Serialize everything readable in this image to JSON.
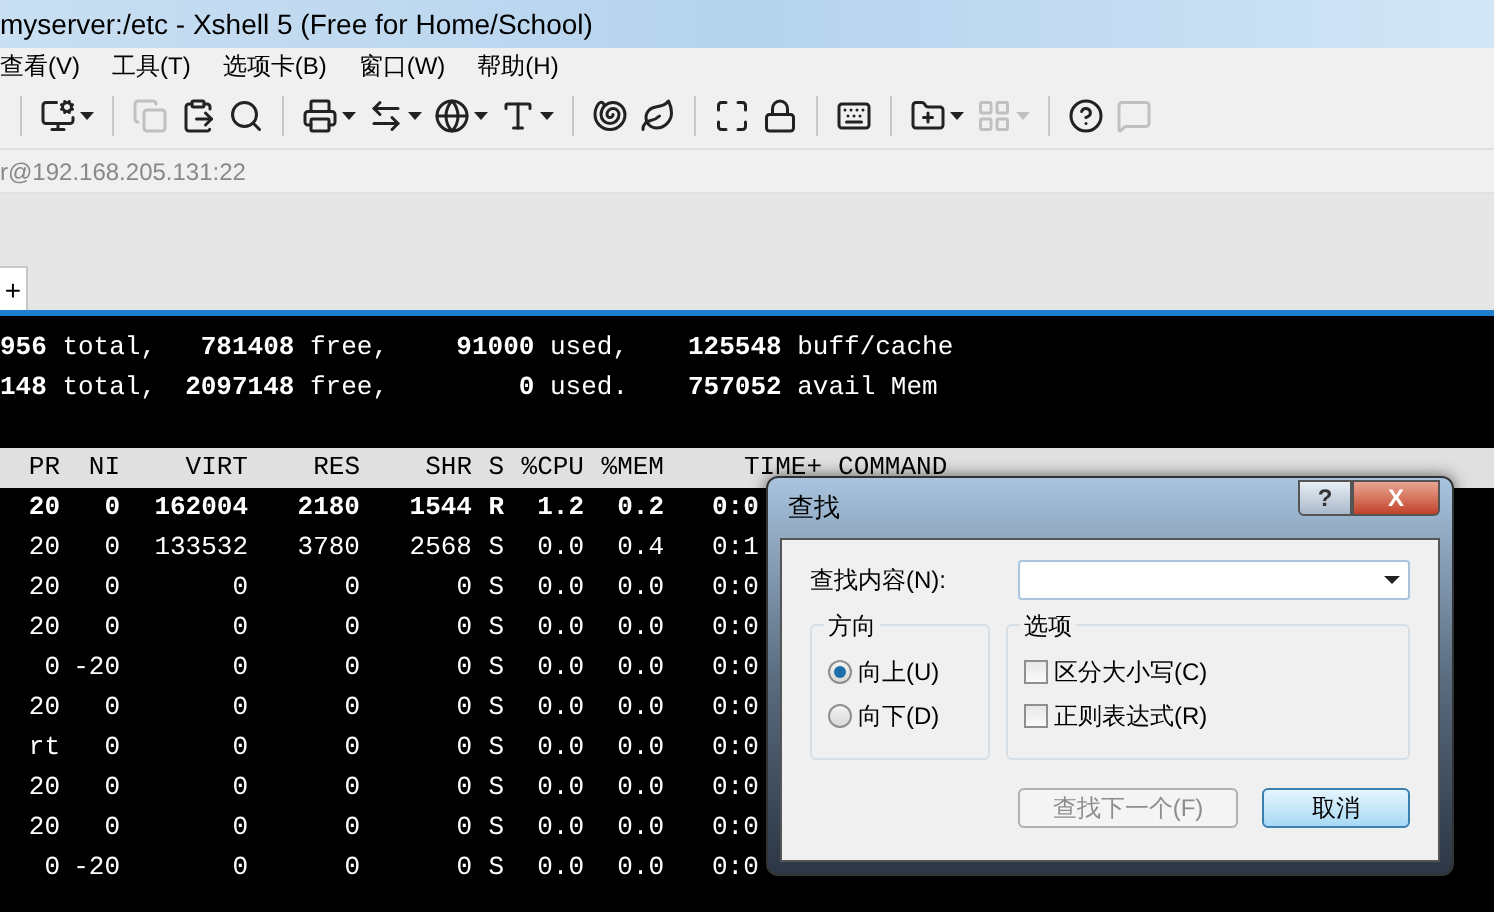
{
  "window": {
    "title": "myserver:/etc - Xshell 5 (Free for Home/School)"
  },
  "menu": [
    "查看(V)",
    "工具(T)",
    "选项卡(B)",
    "窗口(W)",
    "帮助(H)"
  ],
  "toolbar": {
    "groups": [
      [
        {
          "disabled": false,
          "dropdown": true
        }
      ],
      [
        {
          "disabled": true,
          "dropdown": false
        },
        {
          "disabled": false,
          "dropdown": false
        },
        {
          "disabled": false,
          "dropdown": false
        }
      ],
      [
        {
          "disabled": false,
          "dropdown": true
        },
        {
          "disabled": false,
          "dropdown": true
        },
        {
          "disabled": false,
          "dropdown": true
        },
        {
          "disabled": false,
          "dropdown": true
        }
      ],
      [
        {
          "disabled": false,
          "dropdown": false
        },
        {
          "disabled": false,
          "dropdown": false
        }
      ],
      [
        {
          "disabled": false,
          "dropdown": false
        },
        {
          "disabled": false,
          "dropdown": false
        }
      ],
      [
        {
          "disabled": false,
          "dropdown": false
        }
      ],
      [
        {
          "disabled": false,
          "dropdown": true
        },
        {
          "disabled": true,
          "dropdown": true
        }
      ],
      [
        {
          "disabled": false,
          "dropdown": false
        },
        {
          "disabled": true,
          "dropdown": false
        }
      ]
    ]
  },
  "address": "r@192.168.205.131:22",
  "tabs": {
    "add": "+"
  },
  "terminal": {
    "mem_lines": [
      [
        "**956** total,",
        "**781408** free,",
        "**91000** used,",
        "**125548** buff/cache"
      ],
      [
        "**148** total,",
        "**2097148** free,",
        "**0** used.",
        "**757052** avail Mem"
      ]
    ],
    "columns": [
      "PR",
      "NI",
      "VIRT",
      "RES",
      "SHR",
      "S",
      "%CPU",
      "%MEM",
      "TIME+",
      "COMMAND"
    ],
    "rows": [
      {
        "bold": true,
        "cells": [
          "20",
          "0",
          "162004",
          "2180",
          "1544",
          "R",
          "1.2",
          "0.2",
          "0:0"
        ]
      },
      {
        "bold": false,
        "cells": [
          "20",
          "0",
          "133532",
          "3780",
          "2568",
          "S",
          "0.0",
          "0.4",
          "0:1"
        ]
      },
      {
        "bold": false,
        "cells": [
          "20",
          "0",
          "0",
          "0",
          "0",
          "S",
          "0.0",
          "0.0",
          "0:0"
        ]
      },
      {
        "bold": false,
        "cells": [
          "20",
          "0",
          "0",
          "0",
          "0",
          "S",
          "0.0",
          "0.0",
          "0:0"
        ]
      },
      {
        "bold": false,
        "cells": [
          "0",
          "-20",
          "0",
          "0",
          "0",
          "S",
          "0.0",
          "0.0",
          "0:0"
        ]
      },
      {
        "bold": false,
        "cells": [
          "20",
          "0",
          "0",
          "0",
          "0",
          "S",
          "0.0",
          "0.0",
          "0:0"
        ]
      },
      {
        "bold": false,
        "cells": [
          "rt",
          "0",
          "0",
          "0",
          "0",
          "S",
          "0.0",
          "0.0",
          "0:0"
        ]
      },
      {
        "bold": false,
        "cells": [
          "20",
          "0",
          "0",
          "0",
          "0",
          "S",
          "0.0",
          "0.0",
          "0:0"
        ]
      },
      {
        "bold": false,
        "cells": [
          "20",
          "0",
          "0",
          "0",
          "0",
          "S",
          "0.0",
          "0.0",
          "0:0"
        ]
      },
      {
        "bold": false,
        "cells": [
          "0",
          "-20",
          "0",
          "0",
          "0",
          "S",
          "0.0",
          "0.0",
          "0:0"
        ]
      }
    ]
  },
  "dialog": {
    "title": "查找",
    "help": "?",
    "close": "X",
    "find_label": "查找内容(N):",
    "direction": {
      "title": "方向",
      "options": [
        {
          "label": "向上(U)",
          "selected": true
        },
        {
          "label": "向下(D)",
          "selected": false
        }
      ]
    },
    "options": {
      "title": "选项",
      "items": [
        {
          "label": "区分大小写(C)",
          "checked": false
        },
        {
          "label": "正则表达式(R)",
          "checked": false
        }
      ]
    },
    "buttons": [
      {
        "label": "查找下一个(F)",
        "disabled": true,
        "default": false
      },
      {
        "label": "取消",
        "disabled": false,
        "default": true
      }
    ]
  }
}
